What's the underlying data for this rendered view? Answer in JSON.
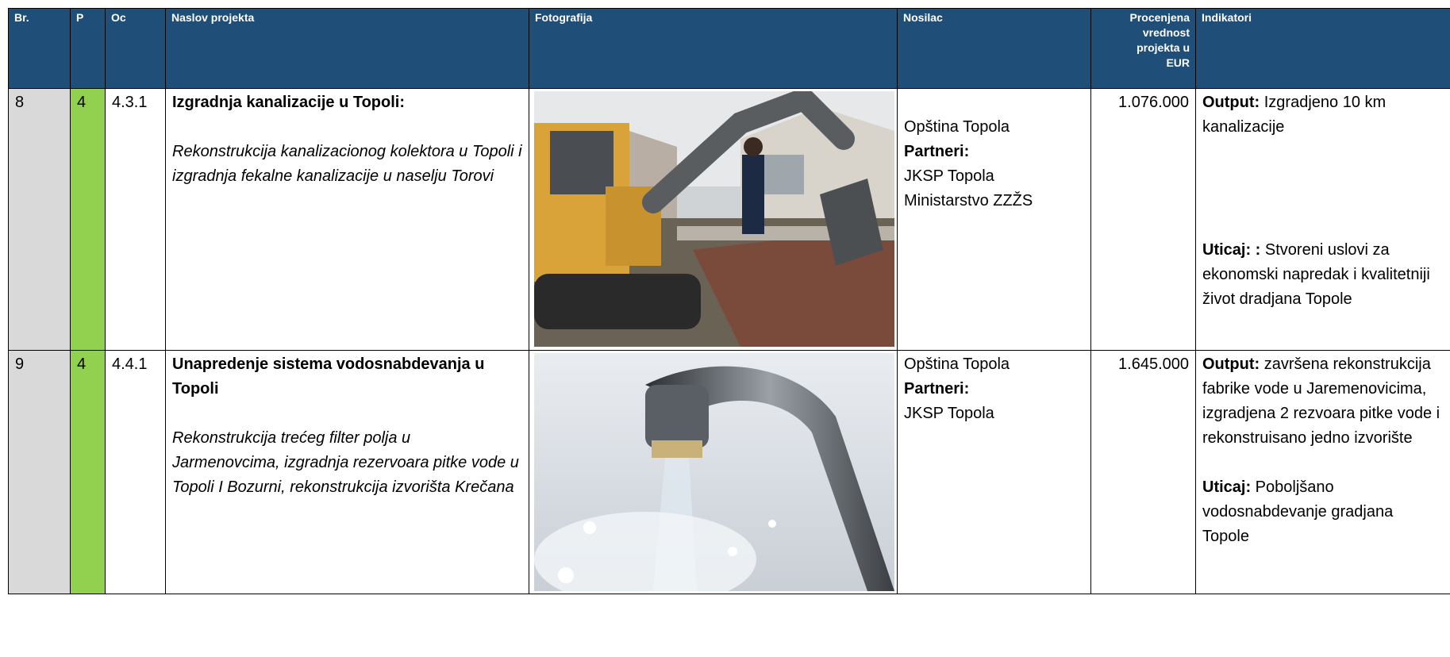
{
  "header": {
    "br": "Br.",
    "p": "P",
    "oc": "Oc",
    "naslov": "Naslov projekta",
    "fotografija": "Fotografija",
    "nosilac": "Nosilac",
    "procenjena_lines": [
      "Procenjena",
      "vrednost",
      "projekta u",
      "EUR"
    ],
    "indikatori": "Indikatori"
  },
  "rows": [
    {
      "br": "8",
      "p": "4",
      "oc": "4.3.1",
      "title": "Izgradnja kanalizacije u Topoli:",
      "description": "Rekonstrukcija kanalizacionog kolektora u Topoli i izgradnja fekalne kanalizacije u naselju Torovi",
      "photo_icon": "excavator-photo",
      "nosilac": "Opština Topola",
      "partneri_label": "Partneri:",
      "partneri": [
        "JKSP Topola",
        "Ministarstvo ZZŽS"
      ],
      "value": "1.076.000",
      "output_label": "Output:",
      "output_text": " Izgradjeno 10 km kanalizacije",
      "uticaj_label": "Uticaj: :",
      "uticaj_text": " Stvoreni uslovi za ekonomski napredak i kvalitetniji život dradjana Topole"
    },
    {
      "br": "9",
      "p": "4",
      "oc": "4.4.1",
      "title": "Unapredenje sistema vodosnabdevanja u Topoli",
      "description": " Rekonstrukcija trećeg filter polja u Jarmenovcima, izgradnja rezervoara pitke vode u Topoli I Bozurni, rekonstrukcija izvorišta Krečana",
      "photo_icon": "water-faucet-photo",
      "nosilac": "Opština Topola",
      "partneri_label": "Partneri:",
      "partneri": [
        "JKSP Topola"
      ],
      "value": "1.645.000",
      "output_label": "Output:",
      "output_text": " završena rekonstrukcija fabrike vode u Jaremenovicima, izgradjena 2 rezvoara pitke vode i rekonstruisano jedno izvorište",
      "uticaj_label": "Uticaj:",
      "uticaj_text": " Poboljšano vodosnabdevanje gradjana Topole"
    }
  ]
}
